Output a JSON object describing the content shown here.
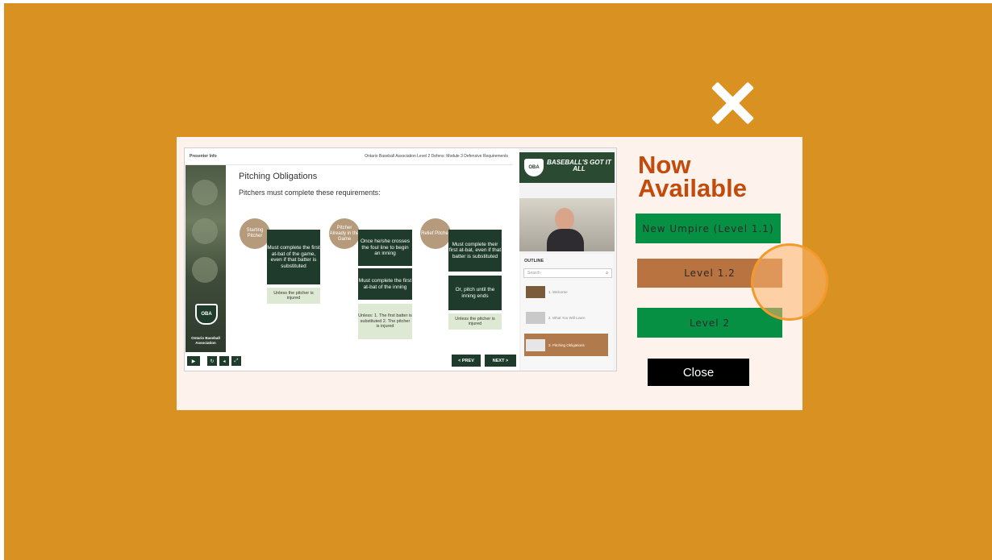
{
  "popup": {
    "headline_line1": "Now",
    "headline_line2": "Available",
    "buttons": [
      "New Umpire (Level 1.1)",
      "Level 1.2",
      "Level 2"
    ],
    "close_label": "Close",
    "close_x_icon": "close-icon"
  },
  "course": {
    "presenter_info": "Presenter Info",
    "course_title": "Ontario Baseball Association Level 2 Defens: Module 3 Defensive Requirements",
    "slide_title": "Pitching Obligations",
    "slide_subtitle": "Pitchers must complete these requirements:",
    "strip_caption": "Ontario Baseball Association",
    "badge": "OBA",
    "columns": [
      {
        "circle": "Starting Pitcher",
        "box": "Must complete the first at-bat of the game, even if that batter is substituted",
        "note": "Unless the pitcher is injured"
      },
      {
        "circle": "Pitcher Already in the Game",
        "box": "Once he/she crosses the foul line to begin an inning",
        "box2": "Must complete the first at-bat of the inning",
        "note": "Unless: 1. The first batter is substituted 2. The pitcher is injured"
      },
      {
        "circle": "Relief Pitcher",
        "box": "Must complete their first at-bat, even if that batter is substituted",
        "box2": "Or, pitch until the inning ends",
        "note": "Unless the pitcher is injured"
      }
    ],
    "prev": "< PREV",
    "next": "NEXT >",
    "banner_text": "BASEBALL'S GOT IT ALL",
    "outline_label": "OUTLINE",
    "search_placeholder": "Search",
    "outline_items": [
      "1. Welcome",
      "2. What You Will Learn",
      "3. Pitching Obligations"
    ]
  },
  "colors": {
    "background": "#d99121",
    "panel": "#fdf2ec",
    "accent": "#c44a0b",
    "green": "#059044",
    "selected": "#b87340"
  }
}
